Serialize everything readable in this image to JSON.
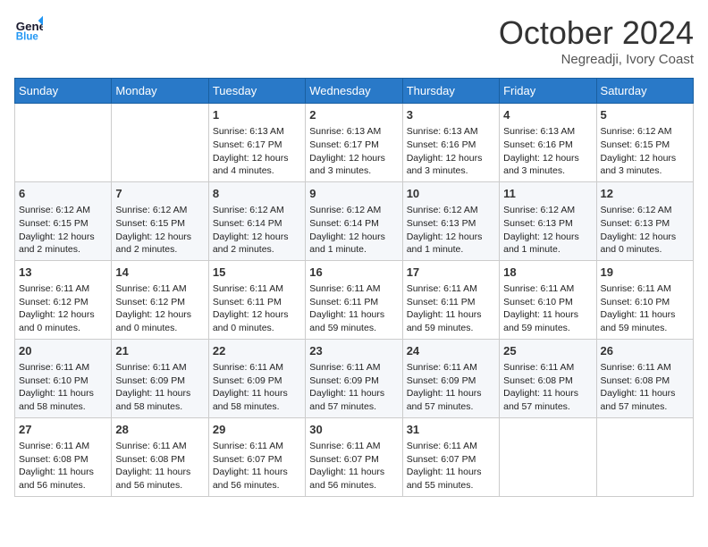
{
  "header": {
    "logo_line1": "General",
    "logo_line2": "Blue",
    "month": "October 2024",
    "location": "Negreadji, Ivory Coast"
  },
  "days_of_week": [
    "Sunday",
    "Monday",
    "Tuesday",
    "Wednesday",
    "Thursday",
    "Friday",
    "Saturday"
  ],
  "weeks": [
    [
      {
        "day": "",
        "info": ""
      },
      {
        "day": "",
        "info": ""
      },
      {
        "day": "1",
        "info": "Sunrise: 6:13 AM\nSunset: 6:17 PM\nDaylight: 12 hours and 4 minutes."
      },
      {
        "day": "2",
        "info": "Sunrise: 6:13 AM\nSunset: 6:17 PM\nDaylight: 12 hours and 3 minutes."
      },
      {
        "day": "3",
        "info": "Sunrise: 6:13 AM\nSunset: 6:16 PM\nDaylight: 12 hours and 3 minutes."
      },
      {
        "day": "4",
        "info": "Sunrise: 6:13 AM\nSunset: 6:16 PM\nDaylight: 12 hours and 3 minutes."
      },
      {
        "day": "5",
        "info": "Sunrise: 6:12 AM\nSunset: 6:15 PM\nDaylight: 12 hours and 3 minutes."
      }
    ],
    [
      {
        "day": "6",
        "info": "Sunrise: 6:12 AM\nSunset: 6:15 PM\nDaylight: 12 hours and 2 minutes."
      },
      {
        "day": "7",
        "info": "Sunrise: 6:12 AM\nSunset: 6:15 PM\nDaylight: 12 hours and 2 minutes."
      },
      {
        "day": "8",
        "info": "Sunrise: 6:12 AM\nSunset: 6:14 PM\nDaylight: 12 hours and 2 minutes."
      },
      {
        "day": "9",
        "info": "Sunrise: 6:12 AM\nSunset: 6:14 PM\nDaylight: 12 hours and 1 minute."
      },
      {
        "day": "10",
        "info": "Sunrise: 6:12 AM\nSunset: 6:13 PM\nDaylight: 12 hours and 1 minute."
      },
      {
        "day": "11",
        "info": "Sunrise: 6:12 AM\nSunset: 6:13 PM\nDaylight: 12 hours and 1 minute."
      },
      {
        "day": "12",
        "info": "Sunrise: 6:12 AM\nSunset: 6:13 PM\nDaylight: 12 hours and 0 minutes."
      }
    ],
    [
      {
        "day": "13",
        "info": "Sunrise: 6:11 AM\nSunset: 6:12 PM\nDaylight: 12 hours and 0 minutes."
      },
      {
        "day": "14",
        "info": "Sunrise: 6:11 AM\nSunset: 6:12 PM\nDaylight: 12 hours and 0 minutes."
      },
      {
        "day": "15",
        "info": "Sunrise: 6:11 AM\nSunset: 6:11 PM\nDaylight: 12 hours and 0 minutes."
      },
      {
        "day": "16",
        "info": "Sunrise: 6:11 AM\nSunset: 6:11 PM\nDaylight: 11 hours and 59 minutes."
      },
      {
        "day": "17",
        "info": "Sunrise: 6:11 AM\nSunset: 6:11 PM\nDaylight: 11 hours and 59 minutes."
      },
      {
        "day": "18",
        "info": "Sunrise: 6:11 AM\nSunset: 6:10 PM\nDaylight: 11 hours and 59 minutes."
      },
      {
        "day": "19",
        "info": "Sunrise: 6:11 AM\nSunset: 6:10 PM\nDaylight: 11 hours and 59 minutes."
      }
    ],
    [
      {
        "day": "20",
        "info": "Sunrise: 6:11 AM\nSunset: 6:10 PM\nDaylight: 11 hours and 58 minutes."
      },
      {
        "day": "21",
        "info": "Sunrise: 6:11 AM\nSunset: 6:09 PM\nDaylight: 11 hours and 58 minutes."
      },
      {
        "day": "22",
        "info": "Sunrise: 6:11 AM\nSunset: 6:09 PM\nDaylight: 11 hours and 58 minutes."
      },
      {
        "day": "23",
        "info": "Sunrise: 6:11 AM\nSunset: 6:09 PM\nDaylight: 11 hours and 57 minutes."
      },
      {
        "day": "24",
        "info": "Sunrise: 6:11 AM\nSunset: 6:09 PM\nDaylight: 11 hours and 57 minutes."
      },
      {
        "day": "25",
        "info": "Sunrise: 6:11 AM\nSunset: 6:08 PM\nDaylight: 11 hours and 57 minutes."
      },
      {
        "day": "26",
        "info": "Sunrise: 6:11 AM\nSunset: 6:08 PM\nDaylight: 11 hours and 57 minutes."
      }
    ],
    [
      {
        "day": "27",
        "info": "Sunrise: 6:11 AM\nSunset: 6:08 PM\nDaylight: 11 hours and 56 minutes."
      },
      {
        "day": "28",
        "info": "Sunrise: 6:11 AM\nSunset: 6:08 PM\nDaylight: 11 hours and 56 minutes."
      },
      {
        "day": "29",
        "info": "Sunrise: 6:11 AM\nSunset: 6:07 PM\nDaylight: 11 hours and 56 minutes."
      },
      {
        "day": "30",
        "info": "Sunrise: 6:11 AM\nSunset: 6:07 PM\nDaylight: 11 hours and 56 minutes."
      },
      {
        "day": "31",
        "info": "Sunrise: 6:11 AM\nSunset: 6:07 PM\nDaylight: 11 hours and 55 minutes."
      },
      {
        "day": "",
        "info": ""
      },
      {
        "day": "",
        "info": ""
      }
    ]
  ]
}
